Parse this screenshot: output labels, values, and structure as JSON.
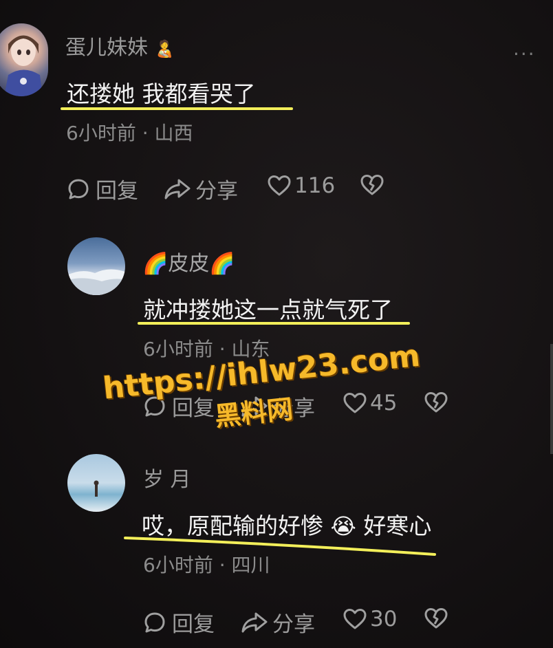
{
  "more_label": "···",
  "comments": [
    {
      "username": "蛋儿妹妹",
      "badge_emoji": "🧑‍🍼",
      "text": "还搂她 我都看哭了",
      "meta": "6小时前 · 山西",
      "reply_label": "回复",
      "share_label": "分享",
      "like_count": "116"
    },
    {
      "username": "🌈皮皮🌈",
      "text": "就冲搂她这一点就气死了",
      "meta": "6小时前 · 山东",
      "reply_label": "回复",
      "share_label": "分享",
      "like_count": "45"
    },
    {
      "username": "岁 月",
      "text_before": "哎，原配输的好惨",
      "emoji": "😭",
      "text_after": "好寒心",
      "meta": "6小时前 · 四川",
      "reply_label": "回复",
      "share_label": "分享",
      "like_count": "30"
    }
  ],
  "watermark": {
    "url": "https://ihlw23.com",
    "name": "黑料网"
  },
  "colors": {
    "background": "#141112",
    "underline": "#f3ef5a",
    "watermark": "#f6b92a"
  }
}
